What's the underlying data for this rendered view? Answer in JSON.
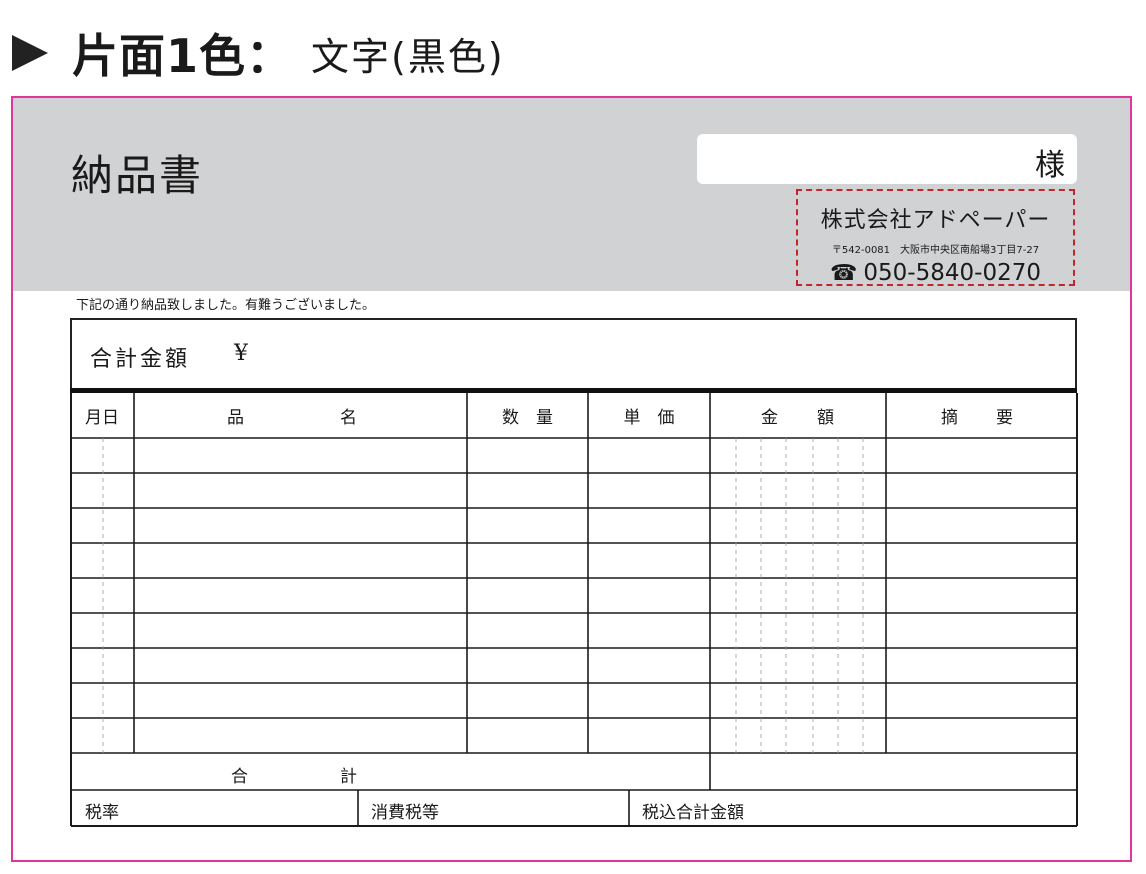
{
  "heading": {
    "bold": "片面1色：",
    "rest": "文字(黒色)"
  },
  "form": {
    "title": "納品書",
    "customer_suffix": "様",
    "company": {
      "name": "株式会社アドペーパー",
      "address": "〒542-0081　大阪市中央区南船場3丁目7-27",
      "tel_icon": "phone-icon",
      "tel": "050-5840-0270"
    },
    "thanks": "下記の通り納品致しました。有難うございました。",
    "total_label": "合計金額",
    "total_yen": "¥",
    "table": {
      "headers": {
        "date": "月日",
        "item_left": "品",
        "item_right": "名",
        "quantity": "数　量",
        "unit_price": "単　価",
        "amount_left": "金",
        "amount_right": "額",
        "remarks_left": "摘",
        "remarks_right": "要"
      },
      "body_rows": 9,
      "subtotal_left": "合",
      "subtotal_right": "計",
      "tax_rate": "税率",
      "consumption_tax": "消費税等",
      "total_with_tax": "税込合計金額"
    }
  },
  "colors": {
    "border_magenta": "#e0359a",
    "band_gray": "#d1d2d4",
    "dashed_red": "#c0272d"
  }
}
